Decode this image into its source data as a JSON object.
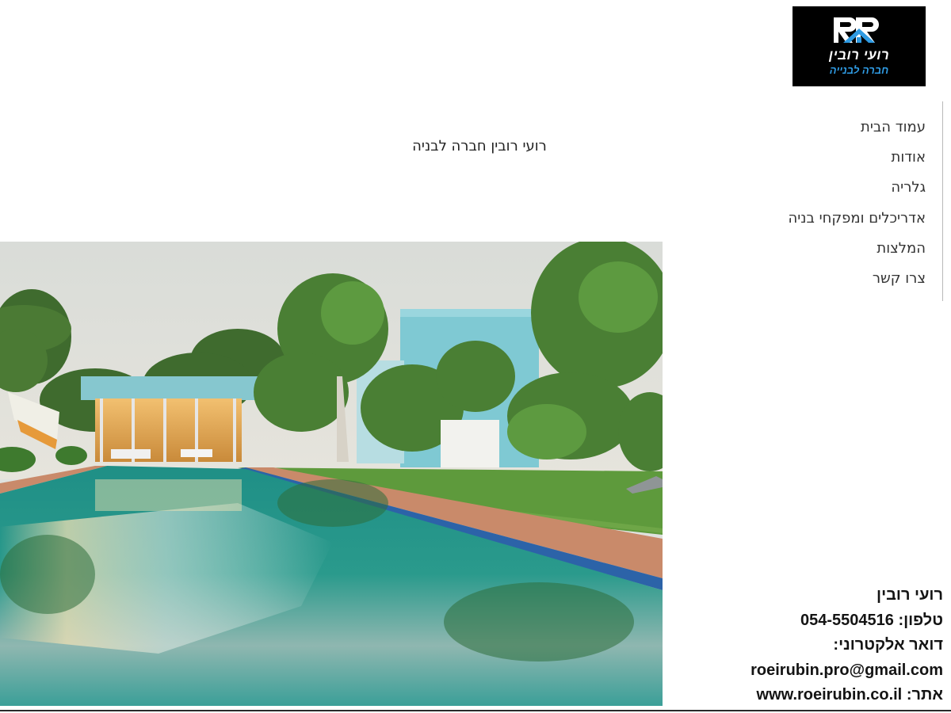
{
  "logo": {
    "initials": "RR",
    "name": "רועי רובין",
    "tagline": "חברה לבנייה"
  },
  "nav": {
    "items": [
      {
        "label": "עמוד הבית"
      },
      {
        "label": "אודות"
      },
      {
        "label": "גלריה"
      },
      {
        "label": "אדריכלים ומפקחי בניה"
      },
      {
        "label": "המלצות"
      },
      {
        "label": "צרו קשר"
      }
    ]
  },
  "header": {
    "title": "רועי רובין חברה לבניה"
  },
  "hero": {
    "image": "villa-with-pool-photo"
  },
  "contact": {
    "name": "רועי רובין",
    "phone_label": "טלפון:",
    "phone": "054-5504516",
    "email_label": "דואר אלקטרוני:",
    "email": "roeirubin.pro@gmail.com",
    "site_label": "אתר:",
    "site": "www.roeirubin.co.il"
  },
  "colors": {
    "logo_bg": "#000000",
    "logo_accent": "#2f9be3",
    "text": "#333333"
  }
}
